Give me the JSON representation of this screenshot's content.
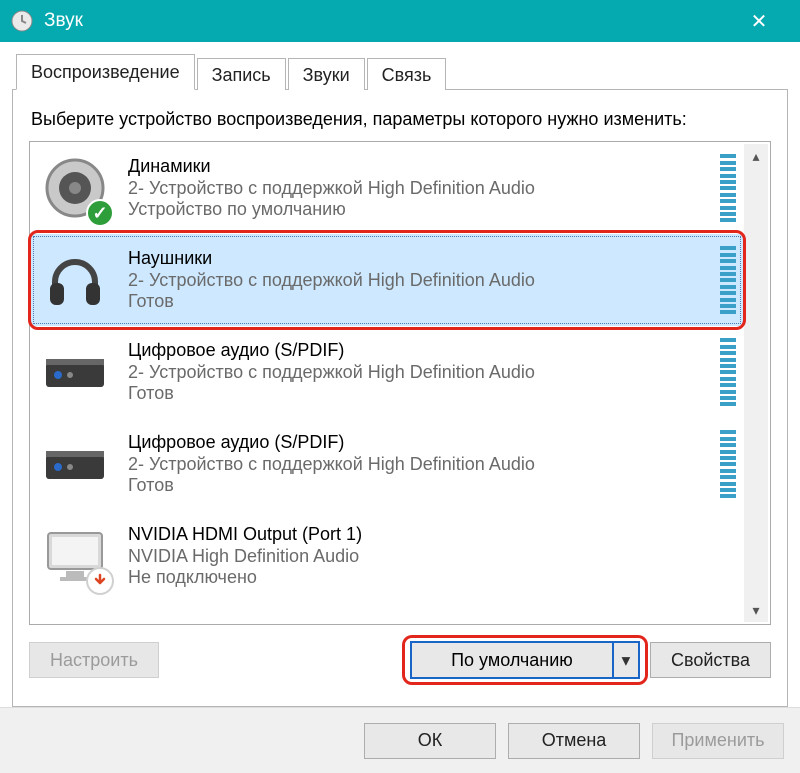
{
  "window": {
    "title": "Звук",
    "close_glyph": "✕"
  },
  "tabs": [
    {
      "id": "playback",
      "label": "Воспроизведение",
      "active": true
    },
    {
      "id": "record",
      "label": "Запись"
    },
    {
      "id": "sounds",
      "label": "Звуки"
    },
    {
      "id": "comm",
      "label": "Связь"
    }
  ],
  "instruction": "Выберите устройство воспроизведения, параметры которого нужно изменить:",
  "devices": [
    {
      "icon": "speaker",
      "badge": "ok",
      "name": "Динамики",
      "desc": "2- Устройство с поддержкой High Definition Audio",
      "status": "Устройство по умолчанию",
      "meter": true,
      "selected": false
    },
    {
      "icon": "headphones",
      "badge": null,
      "name": "Наушники",
      "desc": "2- Устройство с поддержкой High Definition Audio",
      "status": "Готов",
      "meter": true,
      "selected": true
    },
    {
      "icon": "spdif",
      "badge": null,
      "name": "Цифровое аудио (S/PDIF)",
      "desc": "2- Устройство с поддержкой High Definition Audio",
      "status": "Готов",
      "meter": true,
      "selected": false
    },
    {
      "icon": "spdif",
      "badge": null,
      "name": "Цифровое аудио (S/PDIF)",
      "desc": "2- Устройство с поддержкой High Definition Audio",
      "status": "Готов",
      "meter": true,
      "selected": false
    },
    {
      "icon": "monitor",
      "badge": "down",
      "name": "NVIDIA HDMI Output (Port 1)",
      "desc": "NVIDIA High Definition Audio",
      "status": "Не подключено",
      "meter": false,
      "selected": false
    }
  ],
  "buttons": {
    "configure": "Настроить",
    "default": "По умолчанию",
    "properties": "Свойства",
    "ok": "ОК",
    "cancel": "Отмена",
    "apply": "Применить"
  },
  "scroll_glyphs": {
    "up": "▴",
    "down": "▾"
  },
  "dropdown_glyph": "▾",
  "check_glyph": "✓",
  "downarrow_glyph": "↓"
}
